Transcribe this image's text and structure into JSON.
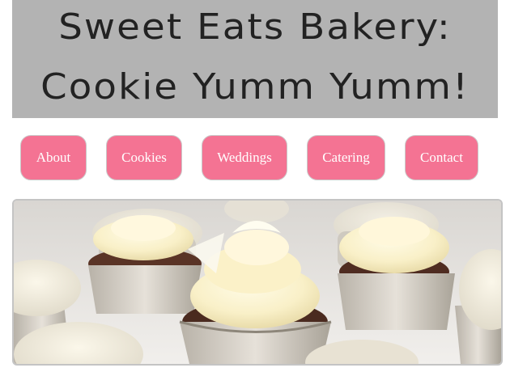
{
  "banner": {
    "line1": "Sweet Eats Bakery:",
    "line2": "Cookie Yumm Yumm!"
  },
  "nav": {
    "items": [
      {
        "label": "About"
      },
      {
        "label": "Cookies"
      },
      {
        "label": "Weddings"
      },
      {
        "label": "Catering"
      },
      {
        "label": "Contact"
      }
    ]
  },
  "colors": {
    "banner_bg": "#b3b3b3",
    "nav_button": "#f47393",
    "nav_text": "#ffffff"
  },
  "hero": {
    "image": "cupcakes-photo"
  }
}
